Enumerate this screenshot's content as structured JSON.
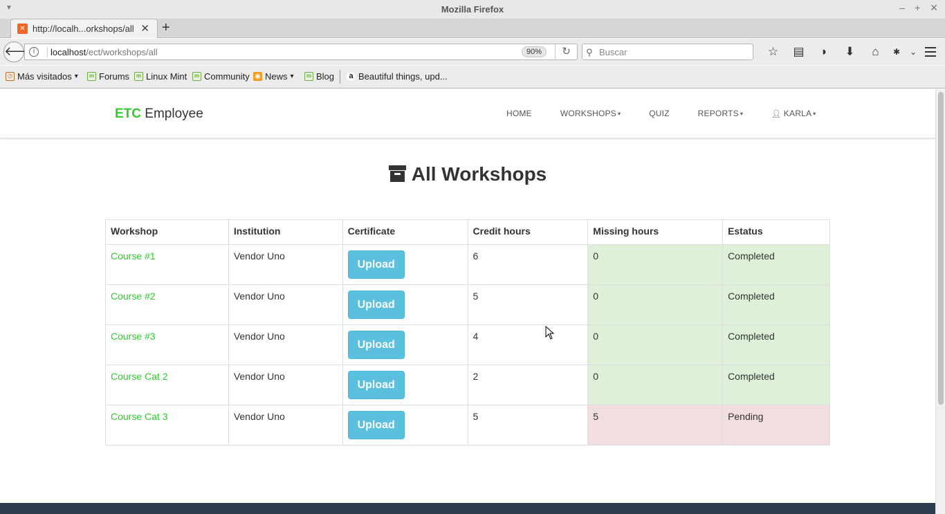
{
  "window": {
    "title": "Mozilla Firefox",
    "controls": [
      "–",
      "+",
      "✕"
    ]
  },
  "tab": {
    "label": "http://localh...orkshops/all",
    "close": "✕",
    "new_tab": "+"
  },
  "navbar": {
    "url_host": "localhost",
    "url_path": "/ect/workshops/all",
    "zoom": "90%",
    "search_placeholder": "Buscar"
  },
  "bookmarks": [
    {
      "label": "Más visitados",
      "icon": "folder-icon"
    },
    {
      "label": "Forums",
      "icon": "mint-icon"
    },
    {
      "label": "Linux Mint",
      "icon": "mint-icon"
    },
    {
      "label": "Community",
      "icon": "mint-icon"
    },
    {
      "label": "News",
      "icon": "rss-icon"
    },
    {
      "label": "Blog",
      "icon": "mint-icon"
    },
    {
      "label": "Beautiful things, upd...",
      "icon": "amazon-icon"
    }
  ],
  "site": {
    "brand_strong": "ETC",
    "brand_rest": " Employee",
    "menu": [
      {
        "label": "HOME",
        "caret": false
      },
      {
        "label": "WORKSHOPS",
        "caret": true
      },
      {
        "label": "QUIZ",
        "caret": false
      },
      {
        "label": "REPORTS",
        "caret": true
      },
      {
        "label": "KARLA",
        "caret": true,
        "user_icon": true
      }
    ]
  },
  "page": {
    "title": "All Workshops"
  },
  "table": {
    "headers": [
      "Workshop",
      "Institution",
      "Certificate",
      "Credit hours",
      "Missing hours",
      "Estatus"
    ],
    "upload_label": "Upload",
    "rows": [
      {
        "workshop": "Course #1",
        "institution": "Vendor Uno",
        "credit": "6",
        "missing": "0",
        "status": "Completed",
        "state": "success"
      },
      {
        "workshop": "Course #2",
        "institution": "Vendor Uno",
        "credit": "5",
        "missing": "0",
        "status": "Completed",
        "state": "success"
      },
      {
        "workshop": "Course #3",
        "institution": "Vendor Uno",
        "credit": "4",
        "missing": "0",
        "status": "Completed",
        "state": "success"
      },
      {
        "workshop": "Course Cat 2",
        "institution": "Vendor Uno",
        "credit": "2",
        "missing": "0",
        "status": "Completed",
        "state": "success"
      },
      {
        "workshop": "Course Cat 3",
        "institution": "Vendor Uno",
        "credit": "5",
        "missing": "5",
        "status": "Pending",
        "state": "danger"
      }
    ]
  },
  "colors": {
    "brand_green": "#2ecc2e",
    "upload_btn": "#5bc0de",
    "success_bg": "#dff0d8",
    "danger_bg": "#f2dede",
    "footer": "#2c3e50"
  }
}
